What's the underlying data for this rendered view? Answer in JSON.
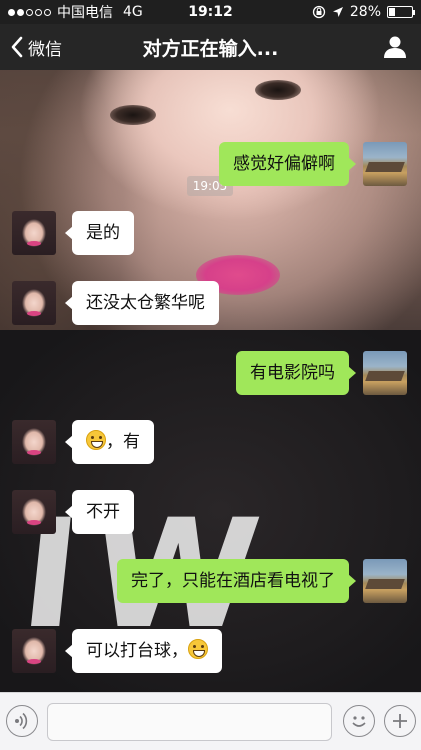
{
  "status_bar": {
    "carrier": "中国电信",
    "network": "4G",
    "time": "19:12",
    "battery": "28%",
    "battery_level": 0.28
  },
  "nav": {
    "back_label": "微信",
    "title": "对方正在输入..."
  },
  "chat": {
    "timestamp": "19:05",
    "messages": [
      {
        "from": "self",
        "text": "感觉好偏僻啊"
      },
      {
        "from": "other",
        "text": "是的"
      },
      {
        "from": "other",
        "text": "还没太仓繁华呢"
      },
      {
        "from": "self",
        "text": "有电影院吗"
      },
      {
        "from": "other",
        "text": "，有",
        "emoji": "grin-emoji",
        "emoji_position": "before"
      },
      {
        "from": "other",
        "text": "不开"
      },
      {
        "from": "self",
        "text": "完了，只能在酒店看电视了"
      },
      {
        "from": "other",
        "text": "可以打台球，",
        "emoji": "grin-emoji",
        "emoji_position": "after"
      }
    ]
  },
  "input_bar": {
    "placeholder": "",
    "value": "",
    "icons": [
      "voice-icon",
      "emoji-icon",
      "plus-icon"
    ]
  },
  "colors": {
    "self_bubble": "#a0e75a",
    "other_bubble": "#ffffff",
    "nav_bar": "#262626",
    "status_bar": "#1f1f1f"
  }
}
